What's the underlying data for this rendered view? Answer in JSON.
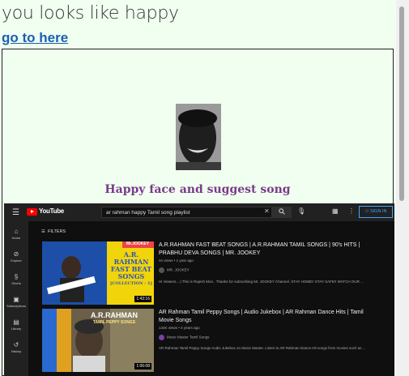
{
  "page": {
    "headline": "you looks like happy",
    "link_text": "go to here",
    "caption": "Happy face and suggest song"
  },
  "youtube": {
    "brand": "YouTube",
    "search_query": "ar rahman happy Tamil song playlist",
    "sign_in": "SIGN IN",
    "filters_label": "FILTERS",
    "sidebar": [
      {
        "label": "Home",
        "icon": "home-icon"
      },
      {
        "label": "Explore",
        "icon": "explore-icon"
      },
      {
        "label": "Shorts",
        "icon": "shorts-icon"
      },
      {
        "label": "Subscriptions",
        "icon": "subscriptions-icon"
      },
      {
        "label": "Library",
        "icon": "library-icon"
      },
      {
        "label": "History",
        "icon": "history-icon"
      }
    ],
    "videos": [
      {
        "title_line1": "A.R.RAHMAN FAST BEAT SONGS | A.R.RAHMAN TAMIL SONGS | 90's HITS |",
        "title_line2": "PRABHU DEVA SONGS | MR. JOOKEY",
        "meta": "nn views • 1 year ago",
        "channel": "MR. JOOKEY",
        "description": "Hi Viewers....| This is Rajesh Mon.. Thanks for subscribing Mr. JOOKEY Channel. STAY HOME!! STAY SAFE!! WATCH OUR ...",
        "duration": "1:43:16",
        "thumb_text": [
          "A.R.",
          "RAHMAN",
          "FAST BEAT",
          "SONGS",
          "[COLLECTION - 1]"
        ],
        "thumb_badge": "Mr.JOOKEY"
      },
      {
        "title_line1": "AR Rahman Tamil Peppy Songs | Audio Jukebox | AR Rahman Dance Hits | Tamil",
        "title_line2": "Movie Songs",
        "meta": "144K views • 4 years ago",
        "channel": "Music Master Tamil Songs",
        "description": "AR Rahman Tamil Peppy Songs Audio Jukebox on Music Master. Listen to AR Rahman Dance Hit songs from movies such as ...",
        "duration": "1:06:08",
        "thumb_text": [
          "A.R.RAHMAN",
          "TAMIL PEPPY SONGS"
        ],
        "thumb_badge": ""
      }
    ]
  }
}
